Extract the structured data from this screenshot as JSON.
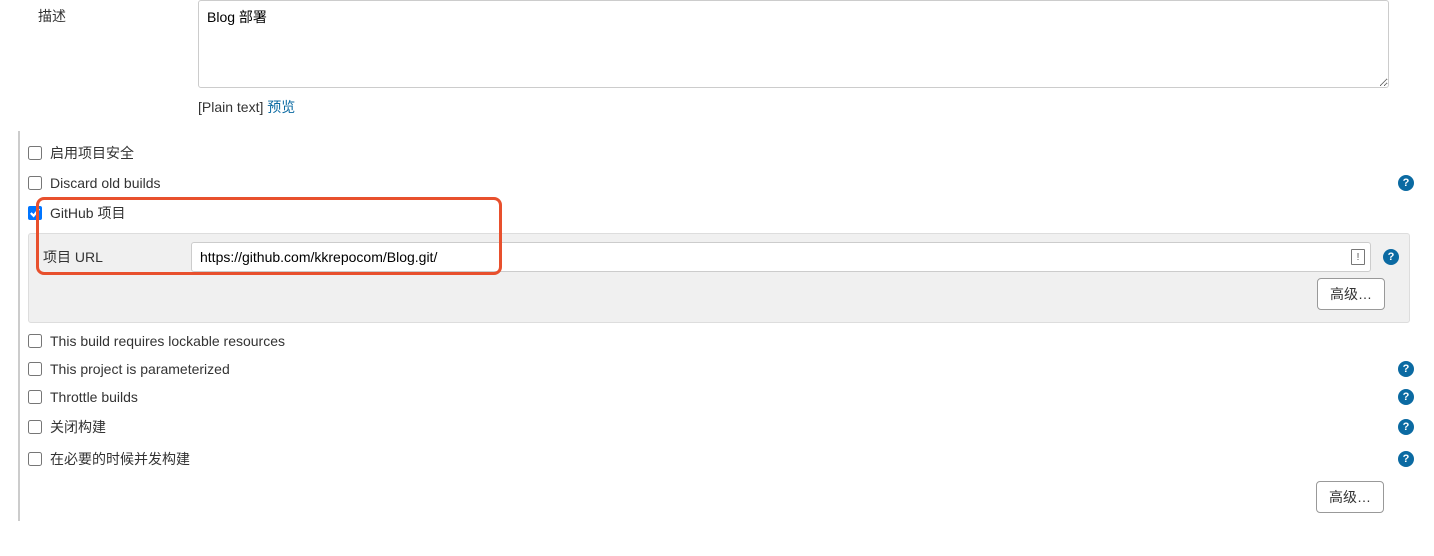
{
  "description": {
    "label": "描述",
    "value": "Blog 部署",
    "plain_text_label": "[Plain text]",
    "preview_label": "预览"
  },
  "options": {
    "enable_security": {
      "label": "启用项目安全",
      "checked": false
    },
    "discard_old_builds": {
      "label": "Discard old builds",
      "checked": false,
      "help": true
    },
    "github_project": {
      "label": "GitHub 项目",
      "checked": true,
      "url_label": "项目 URL",
      "url_value": "https://github.com/kkrepocom/Blog.git/",
      "help": true,
      "advanced_label": "高级…"
    },
    "lockable_resources": {
      "label": "This build requires lockable resources",
      "checked": false
    },
    "parameterized": {
      "label": "This project is parameterized",
      "checked": false,
      "help": true
    },
    "throttle_builds": {
      "label": "Throttle builds",
      "checked": false,
      "help": true
    },
    "disable_build": {
      "label": "关闭构建",
      "checked": false,
      "help": true
    },
    "concurrent_build": {
      "label": "在必要的时候并发构建",
      "checked": false,
      "help": true
    }
  },
  "advanced_label": "高级…",
  "help_glyph": "?"
}
